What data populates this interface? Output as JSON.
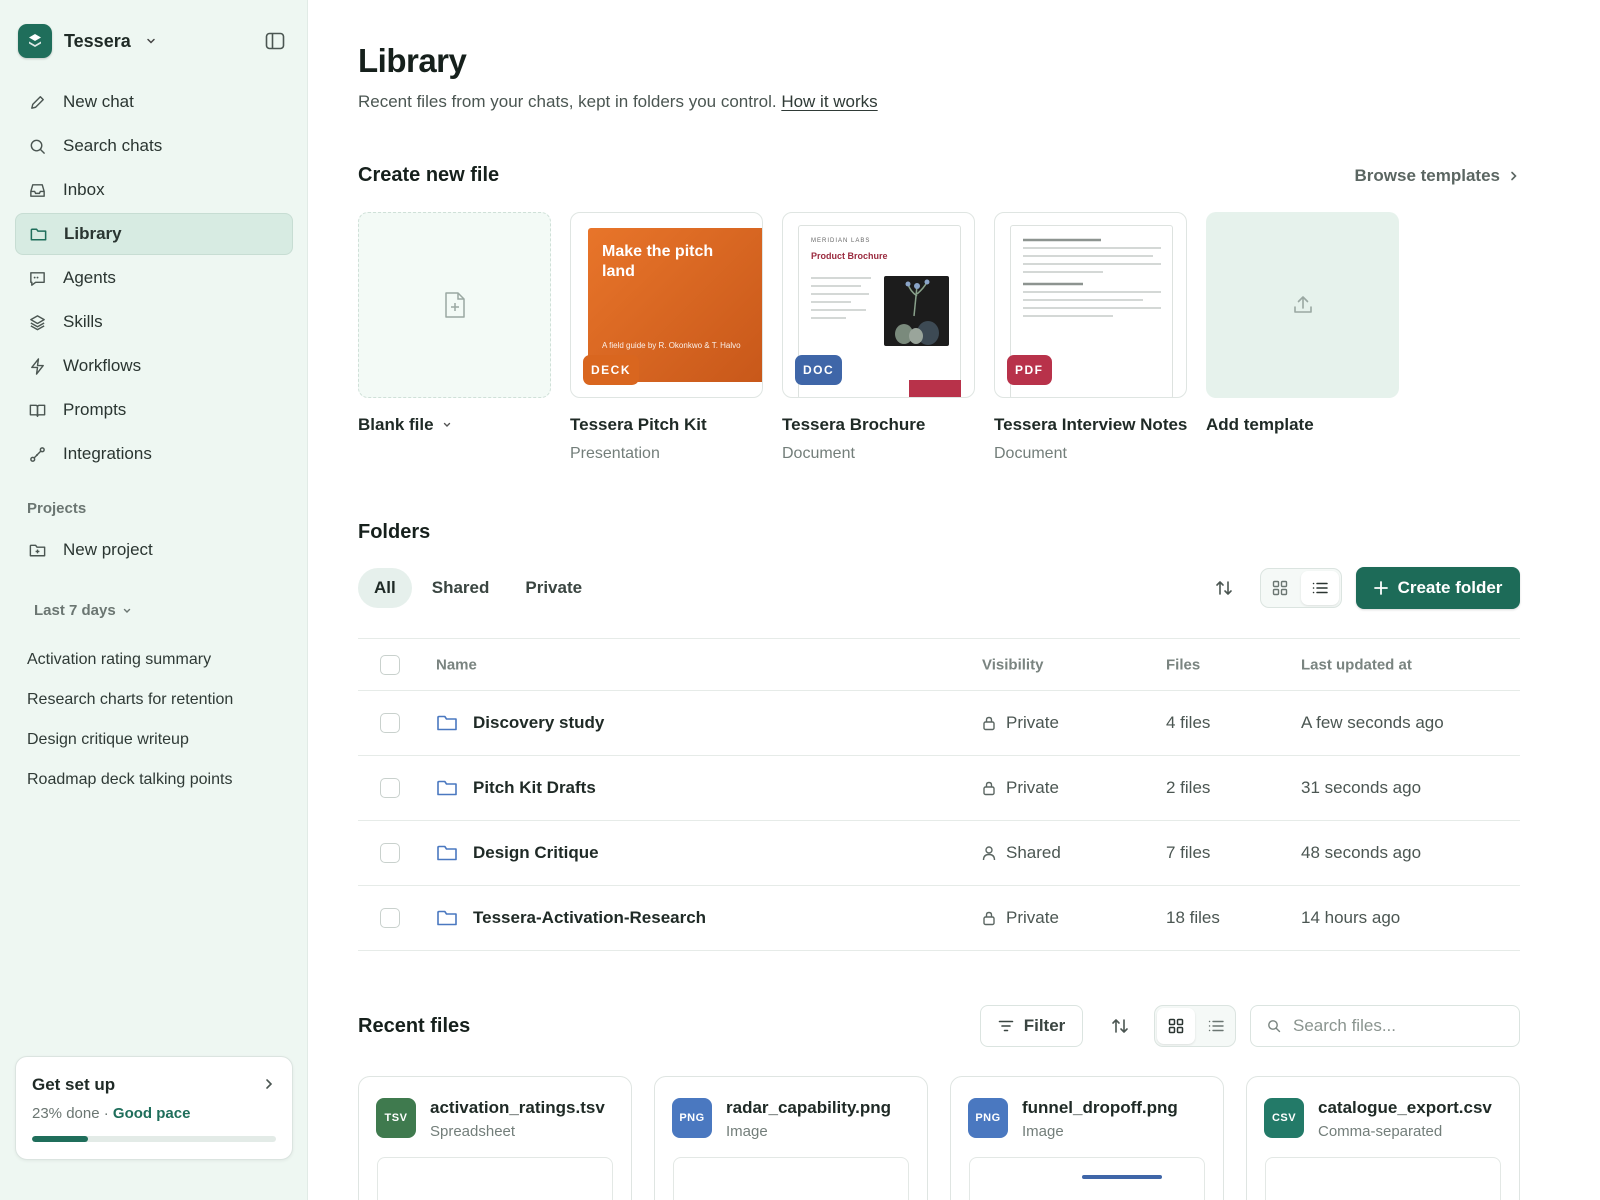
{
  "app": {
    "name": "Tessera",
    "brand_color": "#1f6e5b"
  },
  "sidebar": {
    "nav": [
      {
        "label": "New chat",
        "icon": "pencil-icon"
      },
      {
        "label": "Search chats",
        "icon": "search-icon"
      },
      {
        "label": "Inbox",
        "icon": "inbox-icon"
      },
      {
        "label": "Library",
        "icon": "folder-icon",
        "active": true
      },
      {
        "label": "Agents",
        "icon": "chat-bubble-icon"
      },
      {
        "label": "Skills",
        "icon": "layers-icon"
      },
      {
        "label": "Workflows",
        "icon": "bolt-icon"
      },
      {
        "label": "Prompts",
        "icon": "book-icon"
      },
      {
        "label": "Integrations",
        "icon": "link-nodes-icon"
      }
    ],
    "projects_label": "Projects",
    "new_project_label": "New project",
    "recent_group_label": "Last 7 days",
    "recent_chats": [
      "Activation rating summary",
      "Research charts for retention",
      "Design critique writeup",
      "Roadmap deck talking points"
    ],
    "setup": {
      "title": "Get set up",
      "progress_text": "23% done",
      "separator": "·",
      "pace": "Good pace",
      "progress_fraction": 0.23
    }
  },
  "main": {
    "title": "Library",
    "subtitle": "Recent files from your chats, kept in folders you control.",
    "help_link": "How it works",
    "create": {
      "title": "Create new file",
      "browse_label": "Browse templates",
      "tiles": [
        {
          "name": "Blank file",
          "type": ""
        },
        {
          "name": "Tessera Pitch Kit",
          "type": "Presentation",
          "badge": "DECK",
          "badge_color": "#d9661f",
          "cover_title": "Make the pitch land",
          "cover_footer": "A field guide by R. Okonkwo & T. Halvo"
        },
        {
          "name": "Tessera Brochure",
          "type": "Document",
          "badge": "DOC",
          "badge_color": "#3f66a8",
          "kicker": "MERIDIAN LABS",
          "heading": "Product Brochure"
        },
        {
          "name": "Tessera Interview Notes",
          "type": "Document",
          "badge": "PDF",
          "badge_color": "#b8324a"
        },
        {
          "name": "Add template",
          "type": ""
        }
      ]
    },
    "folders": {
      "title": "Folders",
      "tabs": [
        "All",
        "Shared",
        "Private"
      ],
      "active_tab": "All",
      "create_label": "Create folder",
      "columns": [
        "Name",
        "Visibility",
        "Files",
        "Last updated at"
      ],
      "rows": [
        {
          "name": "Discovery study",
          "visibility": "Private",
          "files": "4 files",
          "updated": "A few seconds ago"
        },
        {
          "name": "Pitch Kit Drafts",
          "visibility": "Private",
          "files": "2 files",
          "updated": "31 seconds ago"
        },
        {
          "name": "Design Critique",
          "visibility": "Shared",
          "files": "7 files",
          "updated": "48 seconds ago"
        },
        {
          "name": "Tessera-Activation-Research",
          "visibility": "Private",
          "files": "18 files",
          "updated": "14 hours ago"
        }
      ]
    },
    "recent_files": {
      "title": "Recent files",
      "filter_label": "Filter",
      "search_placeholder": "Search files...",
      "files": [
        {
          "name": "activation_ratings.tsv",
          "type": "Spreadsheet",
          "ext": "TSV",
          "color": "#3f7a4e"
        },
        {
          "name": "radar_capability.png",
          "type": "Image",
          "ext": "PNG",
          "color": "#4a78c0"
        },
        {
          "name": "funnel_dropoff.png",
          "type": "Image",
          "ext": "PNG",
          "color": "#4a78c0"
        },
        {
          "name": "catalogue_export.csv",
          "type": "Comma-separated",
          "ext": "CSV",
          "color": "#237a68"
        }
      ]
    }
  }
}
